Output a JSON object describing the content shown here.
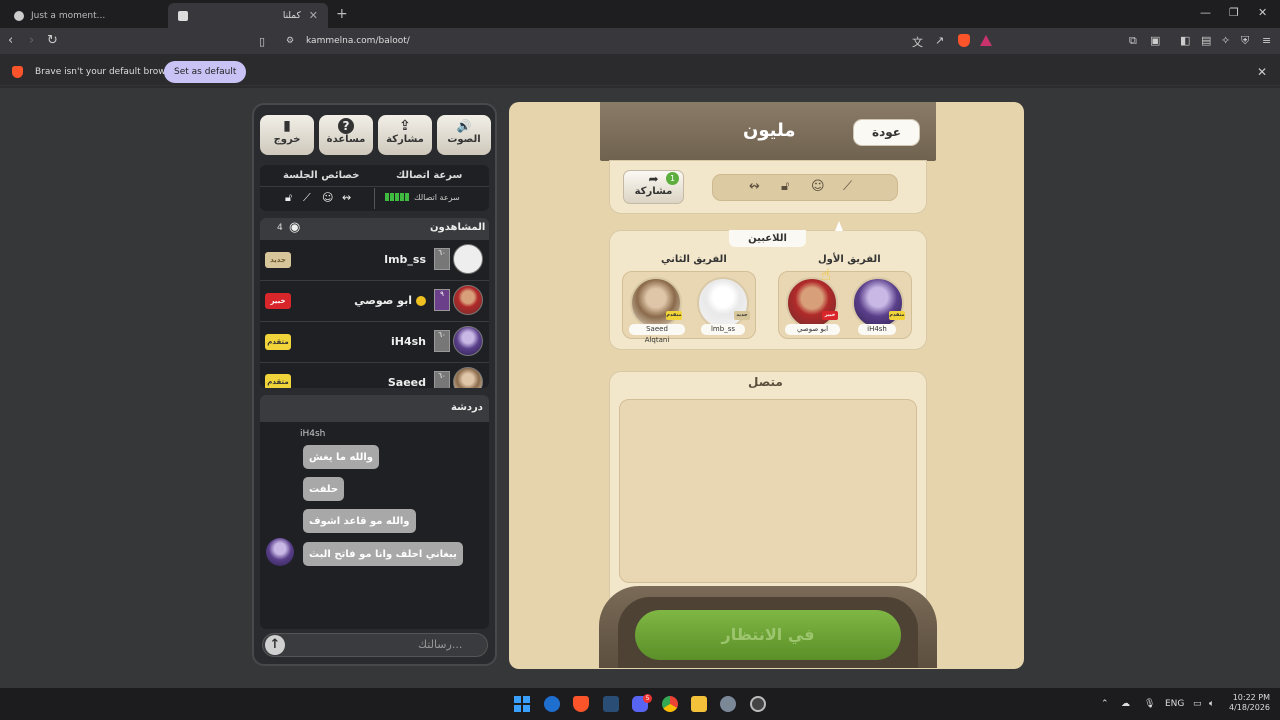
{
  "browser": {
    "tabs": [
      {
        "title": "Just a moment..."
      },
      {
        "title": "كملنا"
      }
    ],
    "url": "kammelna.com/baloot/",
    "infobar_text": "Brave isn't your default browser",
    "set_default_label": "Set as default"
  },
  "left_panel": {
    "toolbar": [
      {
        "label": "خروج",
        "icon": "exit-door-icon",
        "glyph": "▮"
      },
      {
        "label": "مساعدة",
        "icon": "help-icon",
        "glyph": "?"
      },
      {
        "label": "مشاركة",
        "icon": "share-icon",
        "glyph": "⇪"
      },
      {
        "label": "الصوت",
        "icon": "speaker-icon",
        "glyph": "🔊"
      }
    ],
    "session": {
      "props_label": "خصائص الجلسة",
      "speed_label": "سرعة اتصالك",
      "speed_small": "سرعة اتصالك",
      "signal_level": 1.0
    },
    "viewers": {
      "title": "المشاهدون",
      "count": "4",
      "list": [
        {
          "name": "lmb_ss",
          "level": "٦٠",
          "badge": "جديد",
          "badge_color": "#d7c69a"
        },
        {
          "name": "ابو صوصي",
          "level": "٩",
          "badge": "خبير",
          "badge_color": "#d8262b"
        },
        {
          "name": "iH4sh",
          "level": "٦٠",
          "badge": "متقدم",
          "badge_color": "#f0d43a"
        },
        {
          "name": "Saeed Alqtani",
          "level": "٦٠",
          "badge": "متقدم",
          "badge_color": "#f0d43a"
        }
      ]
    },
    "chat": {
      "title": "دردشة",
      "username": "iH4sh",
      "messages": [
        "والله ما يغش",
        "حلفت",
        "والله مو قاعد اشوف",
        "يبغاني احلف وانا مو فاتح البث"
      ],
      "placeholder": "رسالتك..."
    }
  },
  "game": {
    "title": "مليون",
    "back_label": "عودة",
    "share_label": "مشاركة",
    "share_count": "1",
    "players_title": "اللاعبين",
    "team1_label": "الفريق الأول",
    "team2_label": "الفريق الثاني",
    "team1": [
      {
        "name": "ابو صوصي",
        "badge": "خبير",
        "badge_color": "#d8262b"
      },
      {
        "name": "iH4sh",
        "badge": "متقدم",
        "badge_color": "#f0d43a"
      }
    ],
    "team2": [
      {
        "name": "Saeed Alqtani",
        "badge": "متقدم",
        "badge_color": "#f0d43a"
      },
      {
        "name": "lmb_ss",
        "badge": "جديد",
        "badge_color": "#d7c69a"
      }
    ],
    "connected_title": "متصل",
    "waiting_label": "في الانتظار"
  },
  "taskbar": {
    "lang": "ENG",
    "time": "10:22 PM",
    "date": "4/18/2026",
    "discord_badge": "5"
  }
}
